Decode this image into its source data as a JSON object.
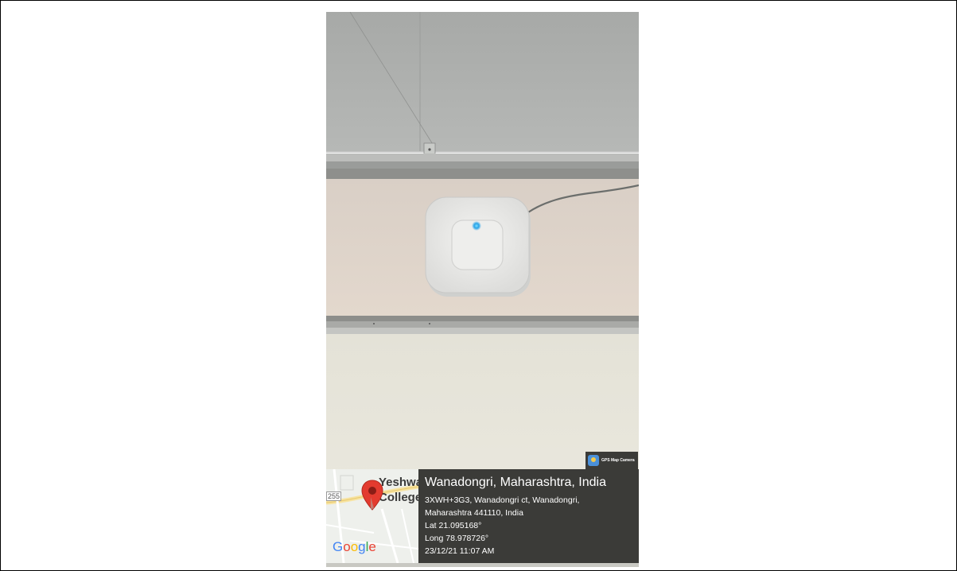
{
  "photo": {
    "app_badge": {
      "label": "GPS Map Camera",
      "icon": "gps-map-camera-icon"
    },
    "map": {
      "labels": [
        "Yeshwa",
        "College"
      ],
      "road_number": "255",
      "logo": [
        "G",
        "o",
        "o",
        "g",
        "l",
        "e"
      ],
      "logo_colors": [
        "#4285F4",
        "#EA4335",
        "#FBBC05",
        "#4285F4",
        "#34A853",
        "#EA4335"
      ],
      "pin_icon": "map-pin-icon"
    },
    "location": {
      "place": "Wanadongri, Maharashtra, India",
      "address_line1": "3XWH+3G3, Wanadongri ct, Wanadongri,",
      "address_line2": "Maharashtra 441110, India",
      "lat": "Lat 21.095168°",
      "long": "Long 78.978726°",
      "datetime": "23/12/21 11:07 AM"
    }
  }
}
